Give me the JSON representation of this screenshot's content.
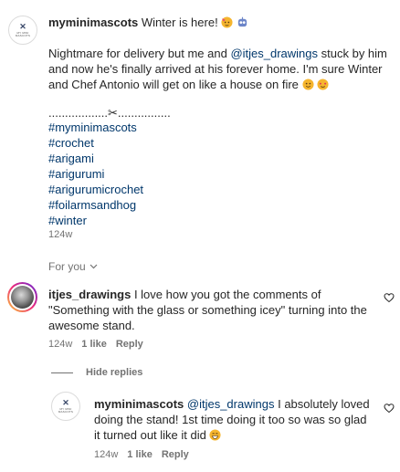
{
  "post": {
    "username": "myminimascots",
    "first_line": "Winter is here!",
    "body_prefix": "Nightmare for delivery but me and",
    "mention": "@itjes_drawings",
    "body_rest_1": "stuck by him",
    "body_line_2": "and now he's finally arrived at his forever home. I'm sure Winter",
    "body_line_3": "and Chef Antonio will get on like a house on fire",
    "divider": "..................✂................",
    "hashtags": [
      "#myminimascots",
      "#crochet",
      "#arigami",
      "#arigurumi",
      "#arigurumicrochet",
      "#foilarmsandhog",
      "#winter"
    ],
    "age": "124w"
  },
  "for_you": "For you",
  "comment1": {
    "username": "itjes_drawings",
    "text_line1": "I love how you got the comments of",
    "text_line2": "\"Something with the glass or something icey\" turning into the",
    "text_line3": "awesome stand.",
    "age": "124w",
    "likes": "1 like",
    "reply": "Reply"
  },
  "hide_replies": "Hide replies",
  "reply1": {
    "username": "myminimascots",
    "mention": "@itjes_drawings",
    "text_line1": "I absolutely loved",
    "text_line2": "doing the stand! 1st time doing it too so was so glad",
    "text_line3": "it turned out like it did",
    "age": "124w",
    "likes": "1 like",
    "reply": "Reply"
  },
  "colors": {
    "link": "#00376b",
    "meta": "#737373",
    "text": "#262626"
  }
}
